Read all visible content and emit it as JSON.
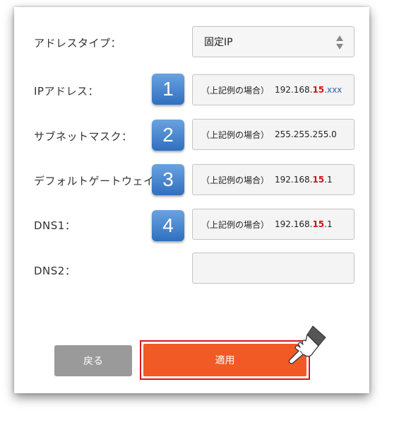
{
  "form": {
    "address_type": {
      "label": "アドレスタイプ：",
      "value": "固定IP"
    },
    "ip_address": {
      "label": "IPアドレス：",
      "badge": "1",
      "prefix": "（上記例の場合）",
      "value_head": "192.168.",
      "value_mid": "15",
      "value_tail": ".xxx"
    },
    "subnet_mask": {
      "label": "サブネットマスク：",
      "badge": "2",
      "prefix": "（上記例の場合）",
      "value": "255.255.255.0"
    },
    "default_gateway": {
      "label": "デフォルトゲートウェイ：",
      "badge": "3",
      "prefix": "（上記例の場合）",
      "value_head": "192.168.",
      "value_mid": "15",
      "value_tail": ".1"
    },
    "dns1": {
      "label": "DNS1：",
      "badge": "4",
      "prefix": "（上記例の場合）",
      "value_head": "192.168.",
      "value_mid": "15",
      "value_tail": ".1"
    },
    "dns2": {
      "label": "DNS2：",
      "value": ""
    }
  },
  "buttons": {
    "back_label": "戻る",
    "apply_label": "適用"
  },
  "colors": {
    "apply": "#f15a24",
    "highlight_outline": "#d9141c",
    "badge": "#2f6fbf",
    "back": "#9a9a9a"
  },
  "icons": {
    "select_arrows": "updown-arrows-icon",
    "pointer": "hand-pointer-icon"
  }
}
